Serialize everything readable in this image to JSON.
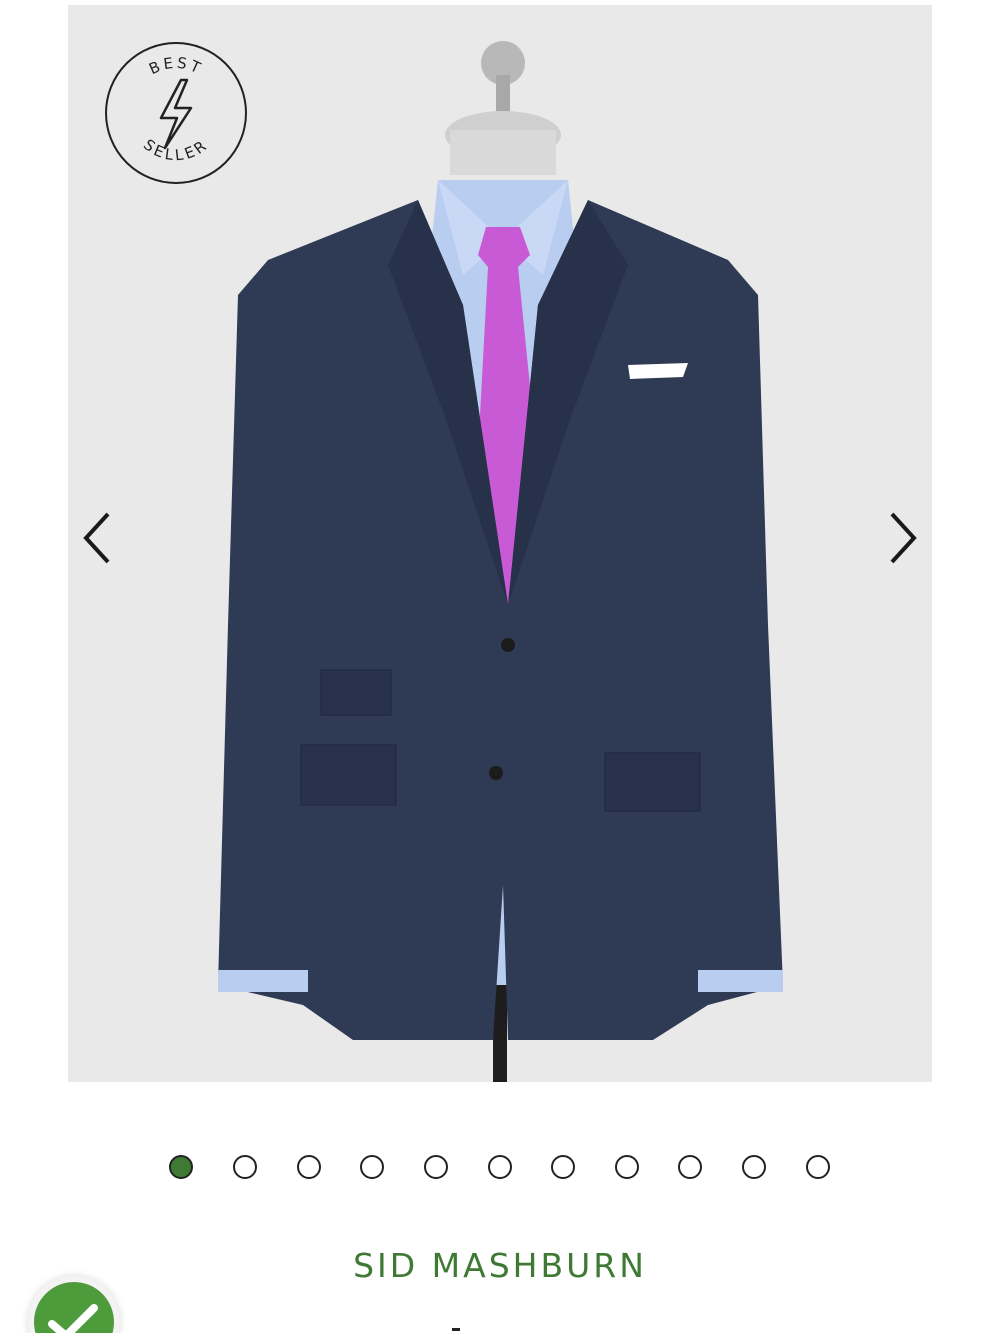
{
  "gallery": {
    "badge": {
      "top_text": "BEST",
      "bottom_text": "SELLER",
      "icon": "lightning-bolt-icon"
    },
    "prev_icon": "chevron-left-icon",
    "next_icon": "chevron-right-icon",
    "slide_count": 11,
    "active_slide": 1
  },
  "product": {
    "brand": "SID MASHBURN"
  },
  "trust_badge": {
    "icon": "checkmark-icon"
  },
  "colors": {
    "accent": "#3f7a34",
    "gallery_bg": "#e9e9e9",
    "jacket": "#2f3a55",
    "tie": "#c85ad6",
    "shirt": "#b9cdf0"
  }
}
